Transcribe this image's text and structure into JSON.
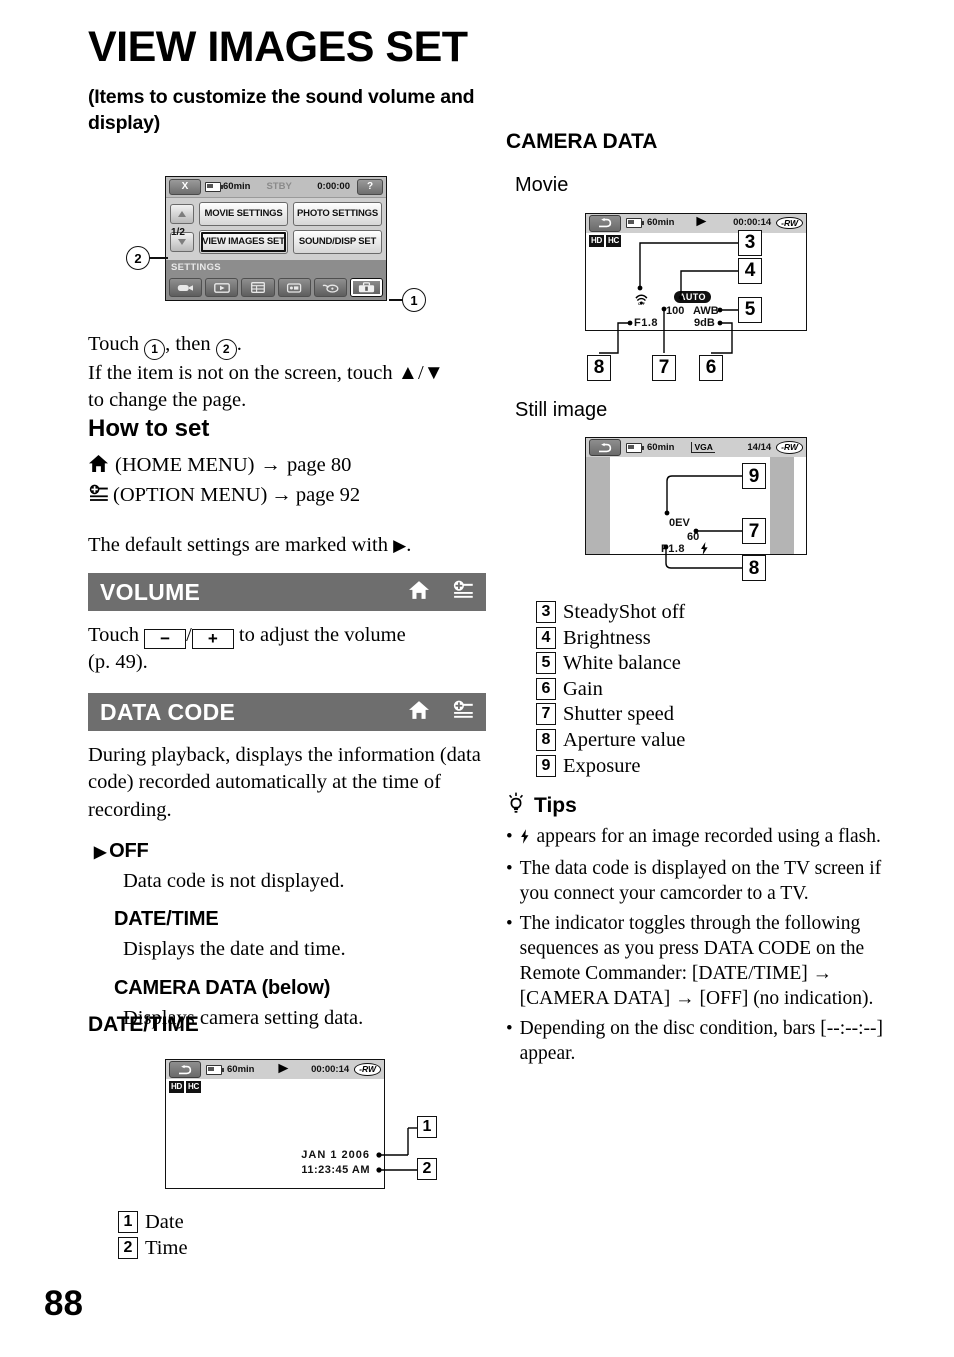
{
  "page": {
    "number": "88",
    "title": "VIEW IMAGES SET",
    "subtitle": "(Items to customize the sound volume and display)"
  },
  "menu_screen": {
    "close_label": "X",
    "battery": "60min",
    "status": "STBY",
    "timecode": "0:00:00",
    "help_label": "?",
    "page_indicator": "1/2",
    "buttons": [
      "MOVIE SETTINGS",
      "PHOTO SETTINGS",
      "VIEW IMAGES SET",
      "SOUND/DISP SET"
    ],
    "selected_button": "VIEW IMAGES SET",
    "category_label": "SETTINGS",
    "tab_icons": [
      "camera-icon",
      "playback-icon",
      "list-icon",
      "media-icon",
      "manage-icon",
      "toolbox-icon"
    ],
    "selected_tab": "toolbox-icon",
    "callouts": [
      "1",
      "2"
    ]
  },
  "instructions": {
    "line1_pre": "Touch ",
    "line1_mid": ", then ",
    "line1_post": ".",
    "line2": "If the item is not on the screen, touch ▲/▼",
    "line3": "to change the page."
  },
  "how_to_set": {
    "heading": "How to set",
    "rows": [
      {
        "icon": "home-icon",
        "label": "(HOME MENU)",
        "arrow": "→",
        "target": "page 80"
      },
      {
        "icon": "option-icon",
        "label": "(OPTION MENU)",
        "arrow": "→",
        "target": "page 92"
      }
    ],
    "default_note_pre": "The default settings are marked with ",
    "default_note_post": "."
  },
  "volume_section": {
    "title": "VOLUME",
    "icons": [
      "home-icon",
      "option-icon"
    ],
    "body_pre": "Touch ",
    "minus": "−",
    "slash": "/",
    "plus": "+",
    "body_post": " to adjust the volume",
    "body_line2": "(p. 49)."
  },
  "data_code_section": {
    "title": "DATA CODE",
    "icons": [
      "home-icon",
      "option-icon"
    ],
    "intro": "During playback, displays the information (data code) recorded automatically at the time of recording.",
    "options": [
      {
        "marker": "▶",
        "name": "OFF",
        "desc": "Data code is not displayed."
      },
      {
        "marker": "",
        "name": "DATE/TIME",
        "desc": "Displays the date and time."
      },
      {
        "marker": "",
        "name": "CAMERA DATA (below)",
        "desc": "Displays camera setting data."
      }
    ]
  },
  "date_time_block": {
    "heading": "DATE/TIME",
    "screen": {
      "battery": "60min",
      "play_icon": "play-icon",
      "timecode": "00:00:14",
      "disc": "-RW",
      "format_badges": [
        "HD",
        "HC"
      ],
      "date": "JAN   1   2006",
      "time": "11:23:45 AM"
    },
    "legend": [
      {
        "num": "1",
        "label": "Date"
      },
      {
        "num": "2",
        "label": "Time"
      }
    ]
  },
  "camera_data_block": {
    "heading": "CAMERA DATA",
    "movie_label": "Movie",
    "movie_screen": {
      "battery": "60min",
      "play_icon": "play-icon",
      "timecode": "00:00:14",
      "disc": "-RW",
      "format_badges": [
        "HD",
        "HC"
      ],
      "steadyshot": "steadyshot-off-icon",
      "exposure_mode": "AUTO",
      "shutter": "100",
      "white_balance": "AWB",
      "aperture": "F1.8",
      "gain": "9dB",
      "callouts": [
        "3",
        "4",
        "5",
        "6",
        "7",
        "8"
      ]
    },
    "still_label": "Still image",
    "still_screen": {
      "battery": "60min",
      "quality": "VGA",
      "counter": "14/14",
      "disc": "-RW",
      "exposure": "0EV",
      "shutter": "60",
      "aperture": "F1.8",
      "flash": "flash-icon",
      "callouts": [
        "9",
        "7",
        "8"
      ]
    },
    "legend": [
      {
        "num": "3",
        "label": "SteadyShot off"
      },
      {
        "num": "4",
        "label": "Brightness"
      },
      {
        "num": "5",
        "label": "White balance"
      },
      {
        "num": "6",
        "label": "Gain"
      },
      {
        "num": "7",
        "label": "Shutter speed"
      },
      {
        "num": "8",
        "label": "Aperture value"
      },
      {
        "num": "9",
        "label": "Exposure"
      }
    ]
  },
  "tips": {
    "heading": "Tips",
    "icon": "tip-bulb-icon",
    "items": [
      {
        "flash_icon": true,
        "text": " appears for an image recorded using a flash."
      },
      {
        "flash_icon": false,
        "text": "The data code is displayed on the TV screen if you connect your camcorder to a TV."
      },
      {
        "flash_icon": false,
        "text": "The indicator toggles through the following sequences as you press DATA CODE on the Remote Commander: [DATE/TIME] → [CAMERA DATA] → [OFF] (no indication)."
      },
      {
        "flash_icon": false,
        "text": "Depending on the disc condition, bars [--:--:--] appear."
      }
    ]
  },
  "colors": {
    "header_bar": "#6e6e6e",
    "screen_bg": "#cfcfcf"
  }
}
